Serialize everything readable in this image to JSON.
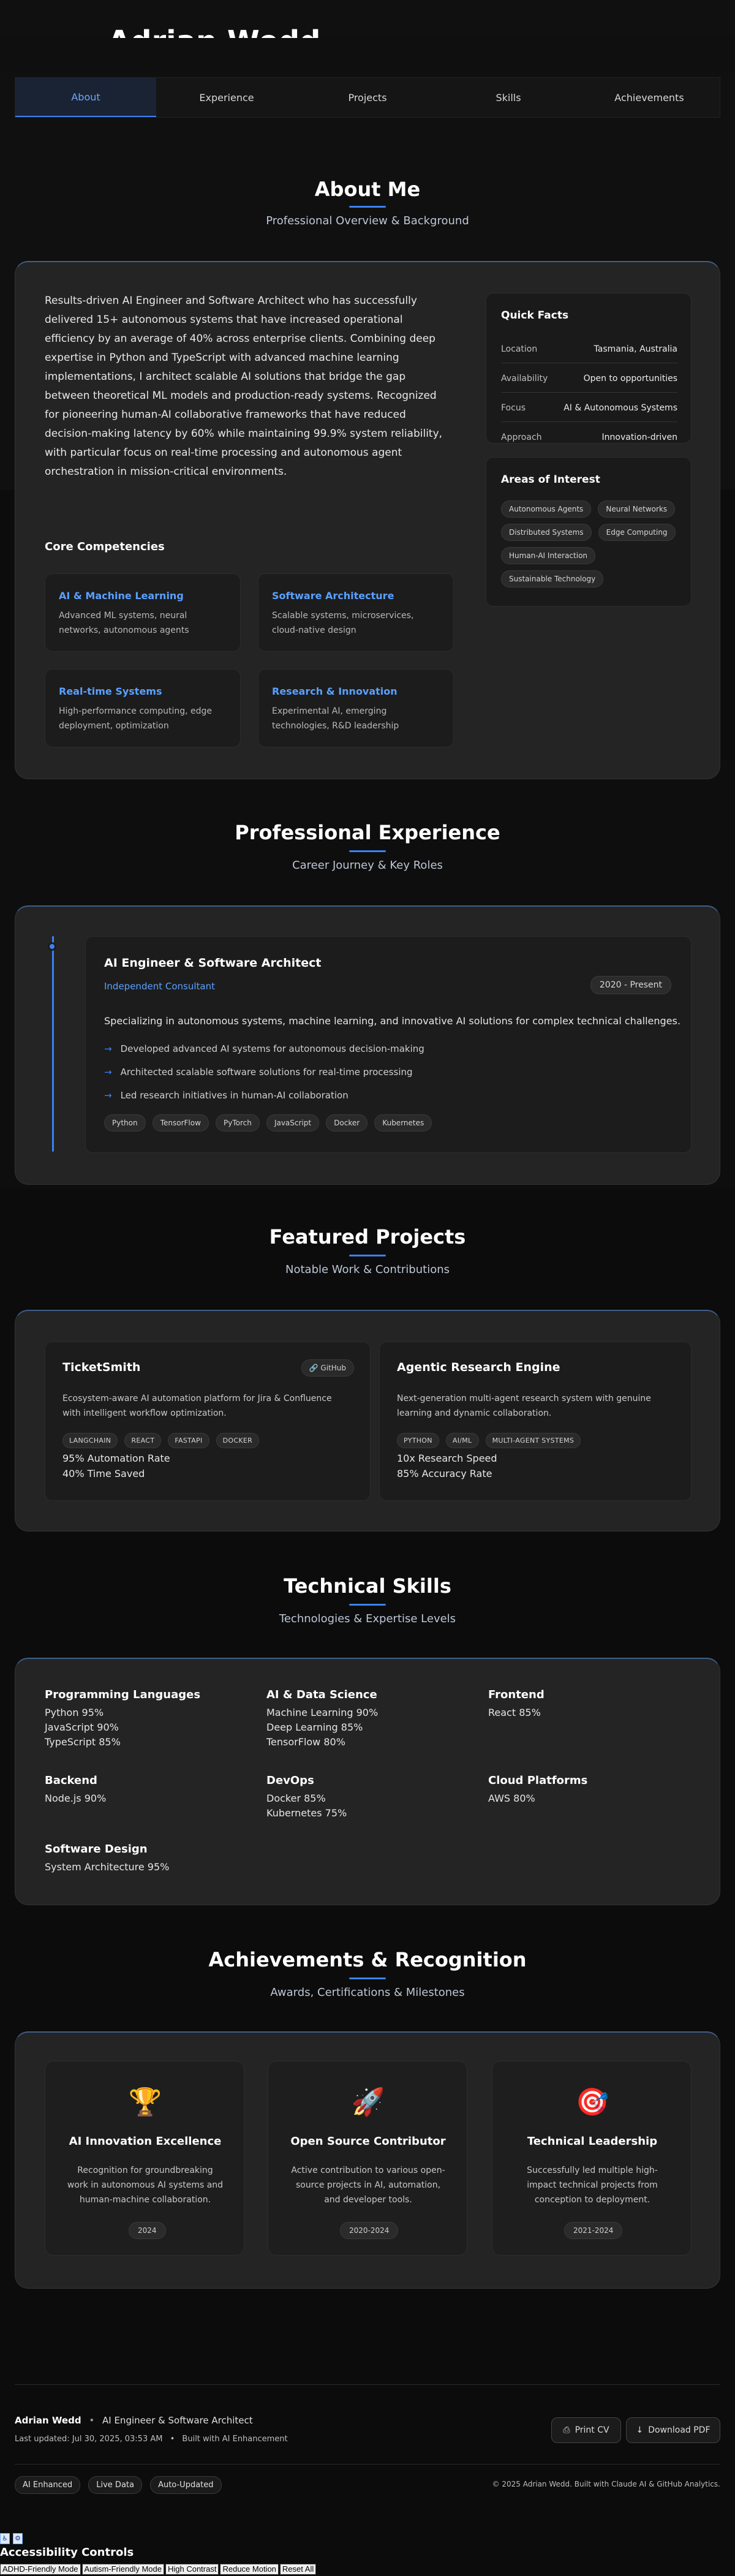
{
  "header": {
    "name": "Adrian Wedd"
  },
  "nav": {
    "tabs": [
      {
        "label": "About",
        "active": true
      },
      {
        "label": "Experience",
        "active": false
      },
      {
        "label": "Projects",
        "active": false
      },
      {
        "label": "Skills",
        "active": false
      },
      {
        "label": "Achievements",
        "active": false
      }
    ]
  },
  "about": {
    "title": "About Me",
    "subtitle": "Professional Overview & Background",
    "intro": "Results-driven AI Engineer and Software Architect who has successfully delivered 15+ autonomous systems that have increased operational efficiency by an average of 40% across enterprise clients. Combining deep expertise in Python and TypeScript with advanced machine learning implementations, I architect scalable AI solutions that bridge the gap between theoretical ML models and production-ready systems. Recognized for pioneering human-AI collaborative frameworks that have reduced decision-making latency by 60% while maintaining 99.9% system reliability, with particular focus on real-time processing and autonomous agent orchestration in mission-critical environments.",
    "competencies_heading": "Core Competencies",
    "competencies": [
      {
        "title": "AI & Machine Learning",
        "desc": "Advanced ML systems, neural networks, autonomous agents"
      },
      {
        "title": "Software Architecture",
        "desc": "Scalable systems, microservices, cloud-native design"
      },
      {
        "title": "Real-time Systems",
        "desc": "High-performance computing, edge deployment, optimization"
      },
      {
        "title": "Research & Innovation",
        "desc": "Experimental AI, emerging technologies, R&D leadership"
      }
    ],
    "quick_facts_heading": "Quick Facts",
    "quick_facts": [
      {
        "k": "Location",
        "v": "Tasmania, Australia"
      },
      {
        "k": "Availability",
        "v": "Open to opportunities"
      },
      {
        "k": "Focus",
        "v": "AI & Autonomous Systems"
      },
      {
        "k": "Approach",
        "v": "Innovation-driven"
      }
    ],
    "interests_heading": "Areas of Interest",
    "interests": [
      "Autonomous Agents",
      "Neural Networks",
      "Distributed Systems",
      "Edge Computing",
      "Human-AI Interaction",
      "Sustainable Technology"
    ]
  },
  "experience": {
    "title": "Professional Experience",
    "subtitle": "Career Journey & Key Roles",
    "role": "AI Engineer & Software Architect",
    "company": "Independent Consultant",
    "period": "2020 - Present",
    "summary": "Specializing in autonomous systems, machine learning, and innovative AI solutions for complex technical challenges.",
    "bullets": [
      "Developed advanced AI systems for autonomous decision-making",
      "Architected scalable software solutions for real-time processing",
      "Led research initiatives in human-AI collaboration"
    ],
    "tech": [
      "Python",
      "TensorFlow",
      "PyTorch",
      "JavaScript",
      "Docker",
      "Kubernetes"
    ]
  },
  "projects": {
    "title": "Featured Projects",
    "subtitle": "Notable Work & Contributions",
    "items": [
      {
        "name": "TicketSmith",
        "link": "GitHub",
        "desc": "Ecosystem-aware AI automation platform for Jira & Confluence with intelligent workflow optimization.",
        "tags": [
          "LANGCHAIN",
          "REACT",
          "FASTAPI",
          "DOCKER"
        ],
        "metrics": [
          "95% Automation Rate",
          "40% Time Saved"
        ]
      },
      {
        "name": "Agentic Research Engine",
        "desc": "Next-generation multi-agent research system with genuine learning and dynamic collaboration.",
        "tags": [
          "PYTHON",
          "AI/ML",
          "MULTI-AGENT SYSTEMS"
        ],
        "metrics": [
          "10x Research Speed",
          "85% Accuracy Rate"
        ]
      }
    ]
  },
  "skills": {
    "title": "Technical Skills",
    "subtitle": "Technologies & Expertise Levels",
    "groups": [
      {
        "name": "Programming Languages",
        "items": [
          "Python 95%",
          "JavaScript 90%",
          "TypeScript 85%"
        ]
      },
      {
        "name": "AI & Data Science",
        "items": [
          "Machine Learning 90%",
          "Deep Learning 85%",
          "TensorFlow 80%"
        ]
      },
      {
        "name": "Frontend",
        "items": [
          "React 85%"
        ]
      },
      {
        "name": "Backend",
        "items": [
          "Node.js 90%"
        ]
      },
      {
        "name": "DevOps",
        "items": [
          "Docker 85%",
          "Kubernetes 75%"
        ]
      },
      {
        "name": "Cloud Platforms",
        "items": [
          "AWS 80%"
        ]
      },
      {
        "name": "Software Design",
        "items": [
          "System Architecture 95%"
        ]
      }
    ]
  },
  "achievements": {
    "title": "Achievements & Recognition",
    "subtitle": "Awards, Certifications & Milestones",
    "items": [
      {
        "icon": "🏆",
        "title": "AI Innovation Excellence",
        "desc": "Recognition for groundbreaking work in autonomous AI systems and human-machine collaboration.",
        "year": "2024"
      },
      {
        "icon": "🚀",
        "title": "Open Source Contributor",
        "desc": "Active contribution to various open-source projects in AI, automation, and developer tools.",
        "year": "2020-2024"
      },
      {
        "icon": "🎯",
        "title": "Technical Leadership",
        "desc": "Successfully led multiple high-impact technical projects from conception to deployment.",
        "year": "2021-2024"
      }
    ]
  },
  "footer": {
    "name": "Adrian Wedd",
    "role": "AI Engineer & Software Architect",
    "updated": "Last updated: Jul 30, 2025, 03:53 AM",
    "built": "Built with AI Enhancement",
    "print_label": "Print CV",
    "download_label": "Download PDF",
    "badges": [
      "AI Enhanced",
      "Live Data",
      "Auto-Updated"
    ],
    "copyright": "© 2025 Adrian Wedd. Built with Claude AI & GitHub Analytics."
  },
  "accessibility": {
    "heading": "Accessibility Controls",
    "buttons": [
      "ADHD-Friendly Mode",
      "Autism-Friendly Mode",
      "High Contrast",
      "Reduce Motion",
      "Reset All"
    ]
  }
}
